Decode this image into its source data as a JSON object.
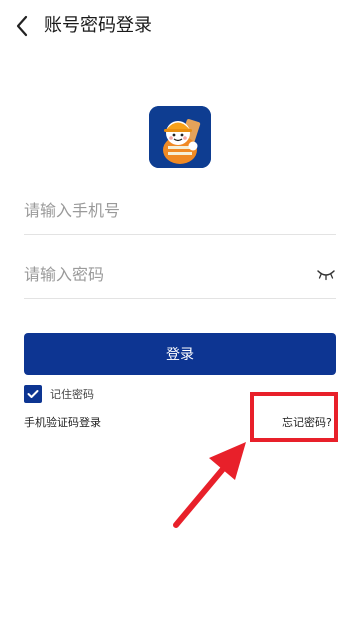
{
  "header": {
    "back_icon": "chevron-left-icon",
    "title": "账号密码登录"
  },
  "logo": {
    "icon": "mascot-logo-icon",
    "color": "#0e3d91"
  },
  "form": {
    "phone_placeholder": "请输入手机号",
    "password_placeholder": "请输入密码",
    "eye_icon": "eye-closed-icon",
    "login_label": "登录",
    "remember_label": "记住密码",
    "remember_checked": true,
    "sms_login_label": "手机验证码登录",
    "forgot_label": "忘记密码?"
  },
  "colors": {
    "accent": "#0d3592",
    "highlight": "#e8202a"
  }
}
